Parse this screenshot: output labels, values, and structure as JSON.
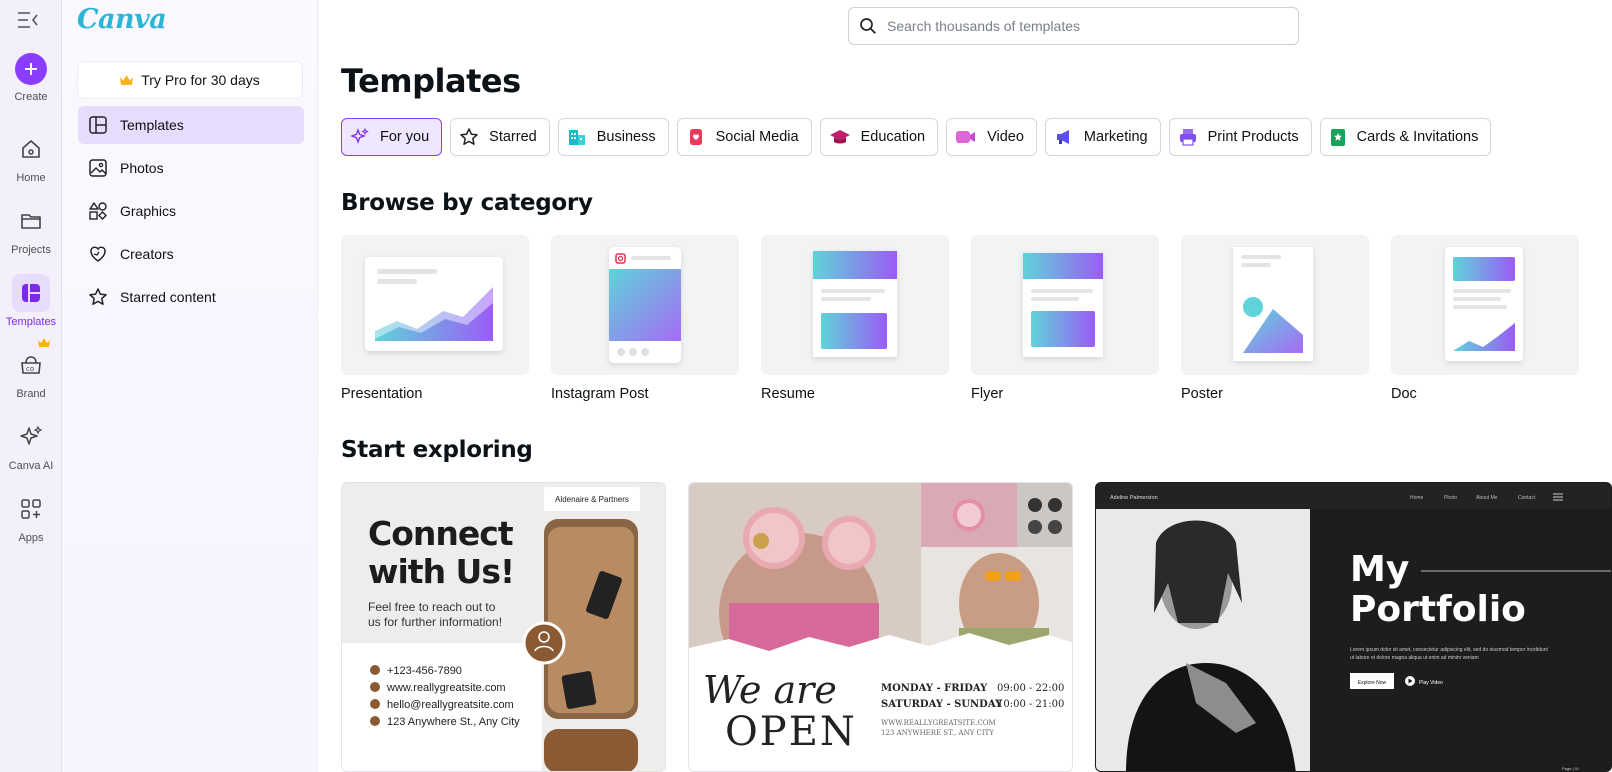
{
  "rail": {
    "create_label": "Create",
    "items": [
      {
        "label": "Home"
      },
      {
        "label": "Projects"
      },
      {
        "label": "Templates"
      },
      {
        "label": "Brand"
      },
      {
        "label": "Canva AI"
      },
      {
        "label": "Apps"
      }
    ]
  },
  "panel": {
    "logo": "Canva",
    "try_pro": "Try Pro for 30 days",
    "nav": [
      {
        "label": "Templates"
      },
      {
        "label": "Photos"
      },
      {
        "label": "Graphics"
      },
      {
        "label": "Creators"
      },
      {
        "label": "Starred content"
      }
    ]
  },
  "search": {
    "placeholder": "Search thousands of templates"
  },
  "page_title": "Templates",
  "chips": [
    {
      "label": "For you"
    },
    {
      "label": "Starred"
    },
    {
      "label": "Business"
    },
    {
      "label": "Social Media"
    },
    {
      "label": "Education"
    },
    {
      "label": "Video"
    },
    {
      "label": "Marketing"
    },
    {
      "label": "Print Products"
    },
    {
      "label": "Cards & Invitations"
    }
  ],
  "browse_title": "Browse by category",
  "categories": [
    {
      "label": "Presentation"
    },
    {
      "label": "Instagram Post"
    },
    {
      "label": "Resume"
    },
    {
      "label": "Flyer"
    },
    {
      "label": "Poster"
    },
    {
      "label": "Doc"
    }
  ],
  "explore_title": "Start exploring",
  "templates": {
    "connect": {
      "company": "Aldenaire & Partners",
      "headline_1": "Connect",
      "headline_2": "with Us!",
      "subline_1": "Feel free to reach out to",
      "subline_2": "us for further information!",
      "phone": "+123-456-7890",
      "web": "www.reallygreatsite.com",
      "email": "hello@reallygreatsite.com",
      "address": "123 Anywhere St., Any City"
    },
    "open": {
      "script": "We are",
      "big": "OPEN",
      "row1_days": "MONDAY - FRIDAY",
      "row1_time": "09:00 - 22:00",
      "row2_days": "SATURDAY - SUNDAY",
      "row2_time": "10:00 - 21:00",
      "site": "WWW.REALLYGREATSITE.COM",
      "address": "123 ANYWHERE ST., ANY CITY"
    },
    "portfolio": {
      "name": "Adeline Palmerston",
      "nav": [
        "Home",
        "Photo",
        "About Me",
        "Contact"
      ],
      "title_1": "My",
      "title_2": "Portfolio",
      "body_1": "Lorem ipsum dolor sit amet, consectetur adipiscing elit, sed do eiusmod tempor incididunt",
      "body_2": "ut labore et dolore magna aliqua ut enim ad minim veniam",
      "btn_explore": "Explore Now",
      "btn_play": "Play Video",
      "page": "Page | 01"
    }
  },
  "colors": {
    "accent": "#8b3dff",
    "accent_bg": "#e7dcfb",
    "teal": "#2bb6d8"
  }
}
